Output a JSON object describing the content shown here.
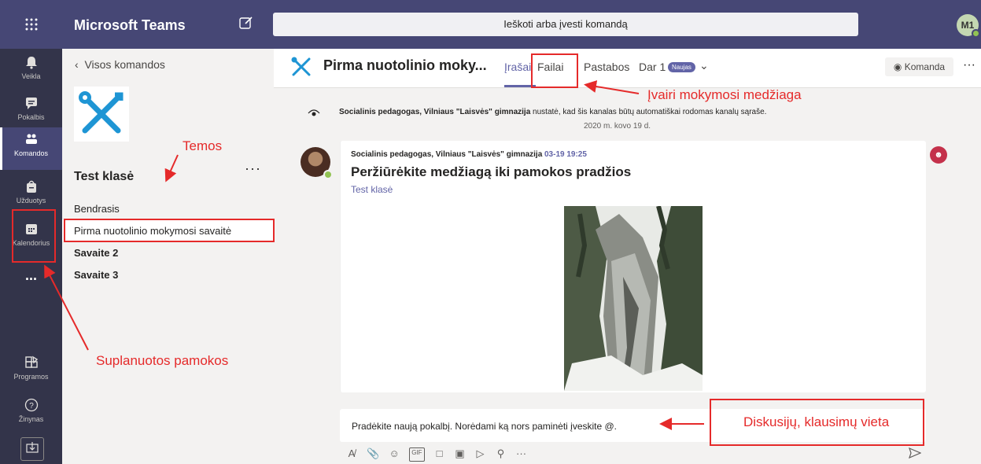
{
  "titlebar": {
    "app_title": "Microsoft Teams",
    "search_placeholder": "Ieškoti arba įvesti komandą",
    "avatar_initials": "M1"
  },
  "rail": {
    "items": [
      {
        "label": "Veikla",
        "icon": "bell-icon"
      },
      {
        "label": "Pokalbis",
        "icon": "chat-icon"
      },
      {
        "label": "Komandos",
        "icon": "teams-icon"
      },
      {
        "label": "Užduotys",
        "icon": "assignments-icon"
      },
      {
        "label": "Kalendorius",
        "icon": "calendar-icon"
      },
      {
        "label": "...",
        "icon": "more-icon"
      },
      {
        "label": "Programos",
        "icon": "apps-icon"
      },
      {
        "label": "Žinynas",
        "icon": "help-icon"
      }
    ]
  },
  "panel": {
    "back_label": "Visos komandos",
    "team_name": "Test klasė",
    "team_more": "···",
    "channels": [
      {
        "label": "Bendrasis"
      },
      {
        "label": "Pirma nuotolinio mokymosi savaitė"
      },
      {
        "label": "Savaite 2"
      },
      {
        "label": "Savaite 3"
      }
    ]
  },
  "header": {
    "channel_title": "Pirma nuotolinio moky...",
    "tabs": [
      {
        "label": "Įrašai"
      },
      {
        "label": "Failai"
      },
      {
        "label": "Pastabos"
      },
      {
        "label": "Dar 1"
      }
    ],
    "new_badge": "Naujas",
    "team_button": "Komanda",
    "more": "···"
  },
  "system_message": {
    "author": "Socialinis pedagogas, Vilniaus \"Laisvės\" gimnazija",
    "text": " nustatė, kad šis kanalas būtų automatiškai rodomas kanalų sąraše.",
    "date": "2020 m. kovo 19 d."
  },
  "post": {
    "author": "Socialinis pedagogas, Vilniaus \"Laisvės\" gimnazija",
    "time": "03-19 19:25",
    "subject": "Peržiūrėkite medžiagą iki pamokos pradžios",
    "team_link": "Test klasė"
  },
  "compose": {
    "placeholder": "Pradėkite naują pokalbį. Norėdami ką nors paminėti įveskite @."
  },
  "annotations": {
    "temos": "Temos",
    "materials": "Įvairi mokymosi medžiaga",
    "planned": "Suplanuotos pamokos",
    "discussion": "Diskusijų, klausimų vieta",
    "color": "#e52a2a"
  },
  "colors": {
    "titlebar": "#464775",
    "rail": "#33344a",
    "accent": "#6264a7"
  }
}
